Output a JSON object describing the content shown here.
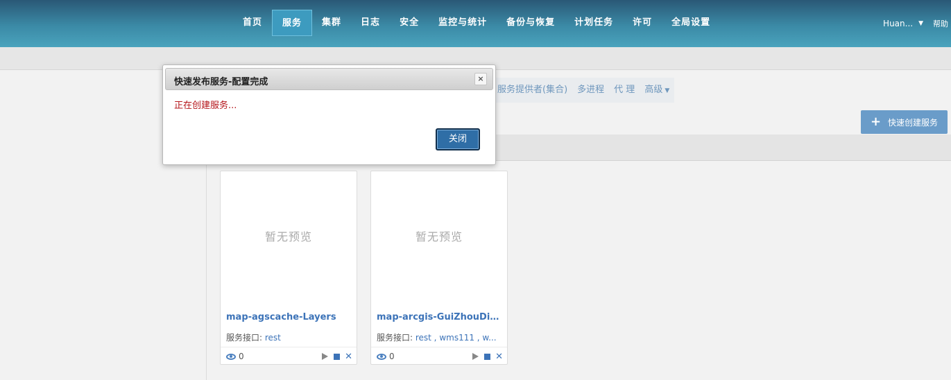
{
  "nav": {
    "items": [
      {
        "label": "首页",
        "active": false
      },
      {
        "label": "服务",
        "active": true
      },
      {
        "label": "集群",
        "active": false
      },
      {
        "label": "日志",
        "active": false
      },
      {
        "label": "安全",
        "active": false
      },
      {
        "label": "监控与统计",
        "active": false
      },
      {
        "label": "备份与恢复",
        "active": false
      },
      {
        "label": "计划任务",
        "active": false
      },
      {
        "label": "许可",
        "active": false
      },
      {
        "label": "全局设置",
        "active": false
      }
    ],
    "user": "Huan...",
    "help": "帮助"
  },
  "tabs": [
    {
      "label": "服务提供者(集合)"
    },
    {
      "label": "多进程"
    },
    {
      "label": "代 理"
    },
    {
      "label": "高级"
    }
  ],
  "quick_create": {
    "label": "快速创建服务"
  },
  "cards": [
    {
      "preview": "暂无预览",
      "title": "map-agscache-Layers",
      "iface_label": "服务接口: ",
      "iface_value": "rest",
      "views": "0"
    },
    {
      "preview": "暂无预览",
      "title": "map-arcgis-GuiZhouDiXin...",
      "iface_label": "服务接口: ",
      "iface_value": "rest , wms111 , w...",
      "views": "0"
    }
  ],
  "modal": {
    "title": "快速发布服务-配置完成",
    "message": "正在创建服务...",
    "close_button": "关闭",
    "close_icon": "×"
  },
  "colors": {
    "nav_gradient_top": "#2a5876",
    "nav_gradient_bottom": "#4aa3bd",
    "accent_blue": "#3c73b8",
    "message_red": "#b5161b",
    "primary_button": "#2f6ea6"
  }
}
